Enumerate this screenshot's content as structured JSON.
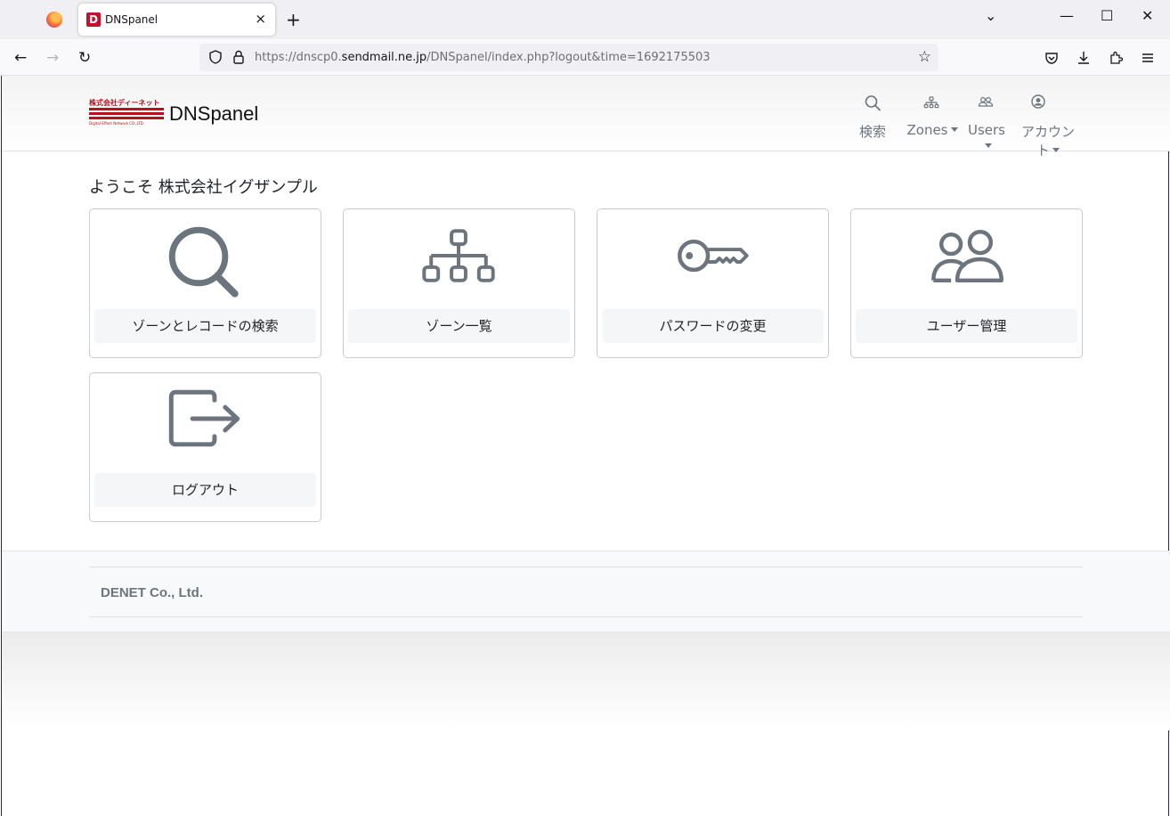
{
  "browser": {
    "tab_title": "DNSpanel",
    "tab_favicon_letter": "D",
    "close_tab_glyph": "×",
    "new_tab_glyph": "+",
    "list_tabs_glyph": "⌄",
    "minimize_glyph": "—",
    "maximize_glyph": "☐",
    "close_window_glyph": "✕",
    "back_glyph": "←",
    "forward_glyph": "→",
    "reload_glyph": "↻",
    "bookmark_glyph": "☆",
    "url_prefix": "https://dnscp0.",
    "url_domain": "sendmail.ne.jp",
    "url_path": "/DNSpanel/index.php?logout&time=1692175503"
  },
  "header": {
    "logo_top": "株式会社ディーネット",
    "logo_bottom": "Digital-Effect Network CO.,LTD.",
    "brand": "DNSpanel",
    "menu": {
      "search": "検索",
      "zones": "Zones",
      "users": "Users",
      "account": "アカウント"
    }
  },
  "main": {
    "welcome": "ようこそ 株式会社イグザンプル",
    "cards": {
      "search": "ゾーンとレコードの検索",
      "zones": "ゾーン一覧",
      "password": "パスワードの変更",
      "users": "ユーザー管理",
      "logout": "ログアウト"
    }
  },
  "footer": {
    "company": "DENET Co., Ltd."
  },
  "colors": {
    "icon_gray": "#6c757d",
    "logo_red": "#b5121b"
  }
}
